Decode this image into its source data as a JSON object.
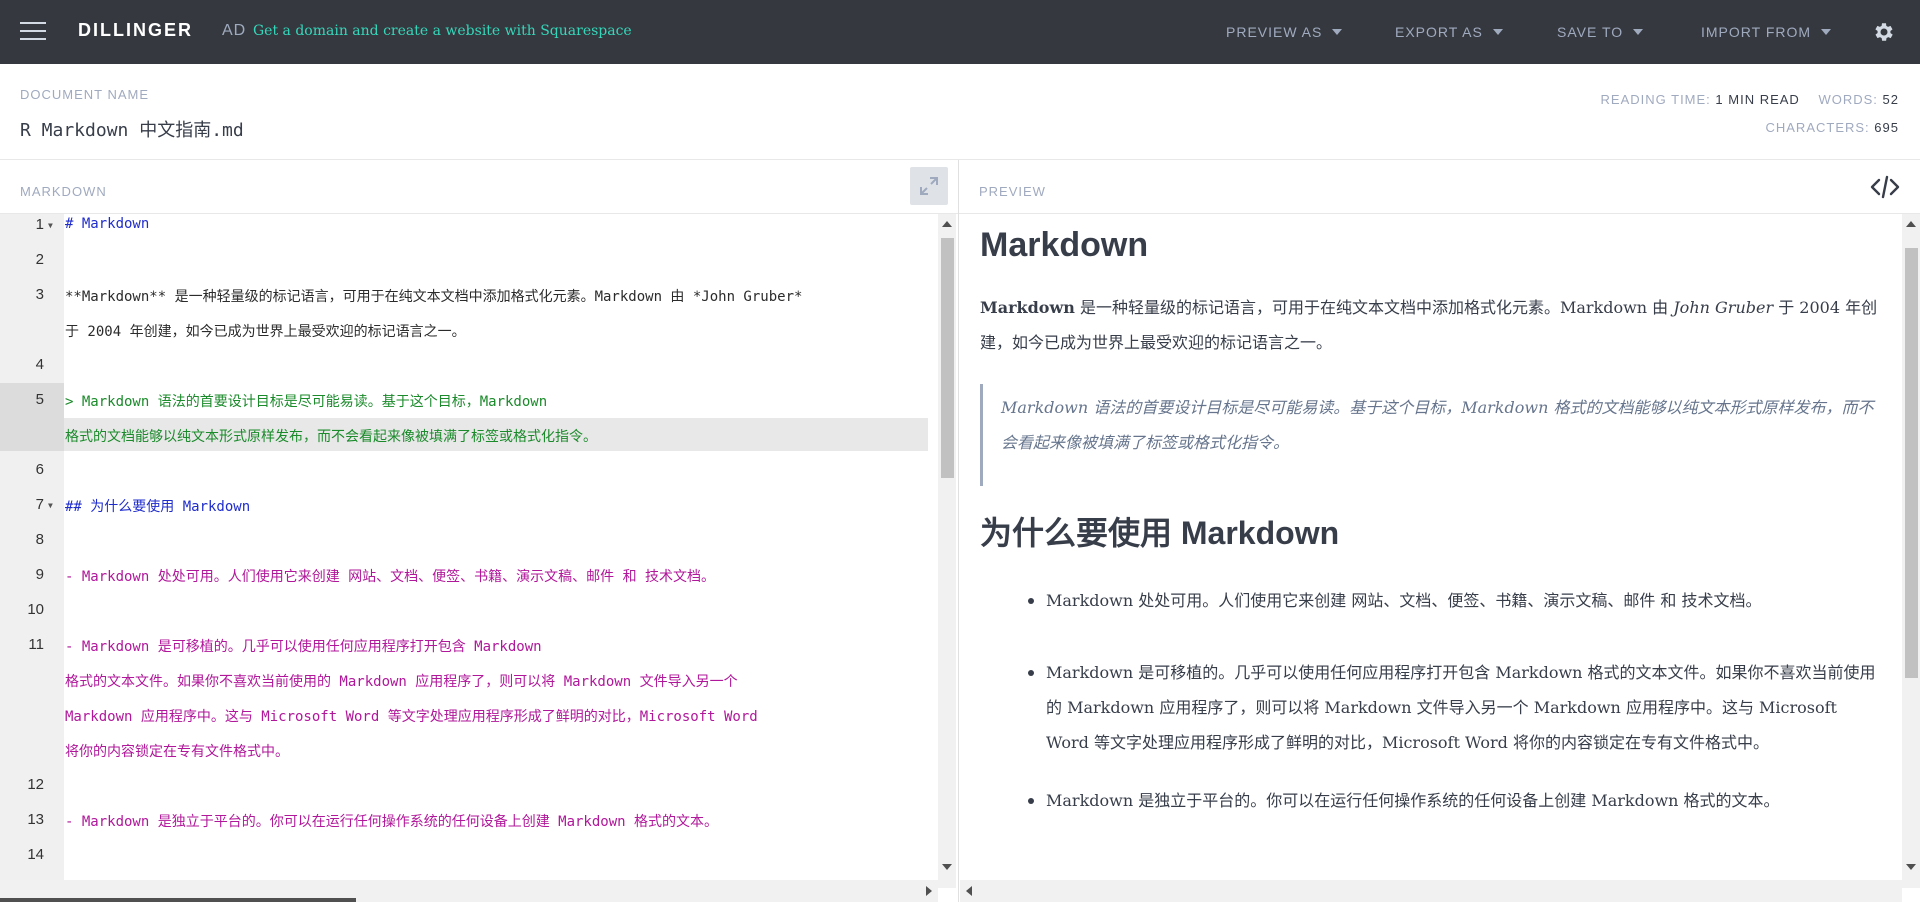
{
  "navbar": {
    "brand": "DILLINGER",
    "ad_label": "AD",
    "ad_text": "Get a domain and create a website with Squarespace",
    "menus": [
      "PREVIEW AS",
      "EXPORT AS",
      "SAVE TO",
      "IMPORT FROM"
    ],
    "icons": {
      "menu": "hamburger-icon",
      "settings": "gear-icon"
    },
    "colors": {
      "background": "#35393f",
      "accent": "#35d7bb"
    }
  },
  "document": {
    "label": "DOCUMENT NAME",
    "name": "R Markdown 中文指南.md",
    "reading_time_label": "READING TIME:",
    "reading_time": "1 MIN READ",
    "words_label": "WORDS:",
    "words": "52",
    "characters_label": "CHARACTERS:",
    "characters": "695"
  },
  "editor": {
    "title": "MARKDOWN",
    "line_numbers": [
      "1",
      "2",
      "3",
      "4",
      "5",
      "6",
      "7",
      "8",
      "9",
      "10",
      "11",
      "12",
      "13",
      "14"
    ],
    "lines": [
      "# Markdown",
      "**Markdown** 是一种轻量级的标记语言，可用于在纯文本文档中添加格式化元素。Markdown 由 *John Gruber*",
      "于 2004 年创建，如今已成为世界上最受欢迎的标记语言之一。",
      "> Markdown 语法的首要设计目标是尽可能易读。基于这个目标，Markdown",
      "格式的文档能够以纯文本形式原样发布，而不会看起来像被填满了标签或格式化指令。",
      "## 为什么要使用 Markdown",
      "- Markdown 处处可用。人们使用它来创建 网站、文档、便签、书籍、演示文稿、邮件 和 技术文档。",
      "- Markdown 是可移植的。几乎可以使用任何应用程序打开包含 Markdown",
      "格式的文本文件。如果你不喜欢当前使用的 Markdown 应用程序了，则可以将 Markdown 文件导入另一个",
      "Markdown 应用程序中。这与 Microsoft Word 等文字处理应用程序形成了鲜明的对比，Microsoft Word",
      "将你的内容锁定在专有文件格式中。",
      "- Markdown 是独立于平台的。你可以在运行任何操作系统的任何设备上创建 Markdown 格式的文本。"
    ],
    "expand_icon": "expand-icon"
  },
  "preview": {
    "title": "PREVIEW",
    "toggle_icon": "code-icon",
    "h1": "Markdown",
    "para_bold": "Markdown",
    "para_a": " 是一种轻量级的标记语言，可用于在纯文本文档中添加格式化元素。Markdown 由 ",
    "para_em": "John Gruber",
    "para_b": " 于 2004 年创建，如今已成为世界上最受欢迎的标记语言之一。",
    "quote": "Markdown 语法的首要设计目标是尽可能易读。基于这个目标，Markdown 格式的文档能够以纯文本形式原样发布，而不会看起来像被填满了标签或格式化指令。",
    "h2": "为什么要使用 Markdown",
    "list": [
      "Markdown 处处可用。人们使用它来创建 网站、文档、便签、书籍、演示文稿、邮件 和 技术文档。",
      "Markdown 是可移植的。几乎可以使用任何应用程序打开包含 Markdown 格式的文本文件。如果你不喜欢当前使用的 Markdown 应用程序了，则可以将 Markdown 文件导入另一个 Markdown 应用程序中。这与 Microsoft Word 等文字处理应用程序形成了鲜明的对比，Microsoft Word 将你的内容锁定在专有文件格式中。",
      "Markdown 是独立于平台的。你可以在运行任何操作系统的任何设备上创建 Markdown 格式的文本。"
    ]
  }
}
